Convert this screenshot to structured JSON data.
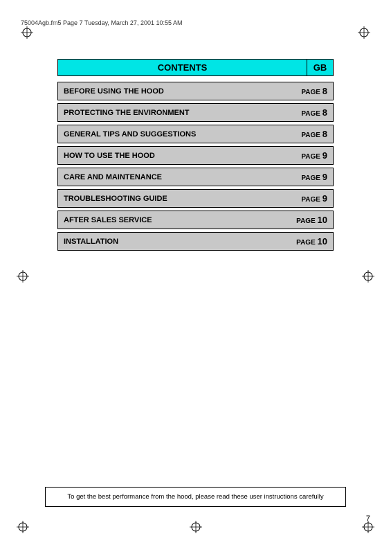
{
  "header": {
    "filename": "75004Agb.fm5  Page 7  Tuesday, March 27, 2001  10:55 AM"
  },
  "contents": {
    "title": "CONTENTS",
    "gb_label": "GB",
    "rows": [
      {
        "label": "BEFORE USING THE HOOD",
        "page_text": "PAGE",
        "page_num": "8"
      },
      {
        "label": "PROTECTING THE ENVIRONMENT",
        "page_text": "PAGE",
        "page_num": "8"
      },
      {
        "label": "GENERAL TIPS AND SUGGESTIONS",
        "page_text": "PAGE",
        "page_num": "8"
      },
      {
        "label": "HOW TO USE THE HOOD",
        "page_text": "PAGE",
        "page_num": "9"
      },
      {
        "label": "CARE AND MAINTENANCE",
        "page_text": "PAGE",
        "page_num": "9"
      },
      {
        "label": "TROUBLESHOOTING GUIDE",
        "page_text": "PAGE",
        "page_num": "9"
      },
      {
        "label": "AFTER SALES SERVICE",
        "page_text": "PAGE",
        "page_num": "10"
      },
      {
        "label": "INSTALLATION",
        "page_text": "PAGE",
        "page_num": "10"
      }
    ]
  },
  "bottom_note": "To get the best performance from the hood, please read these user instructions carefully",
  "page_number": "7"
}
